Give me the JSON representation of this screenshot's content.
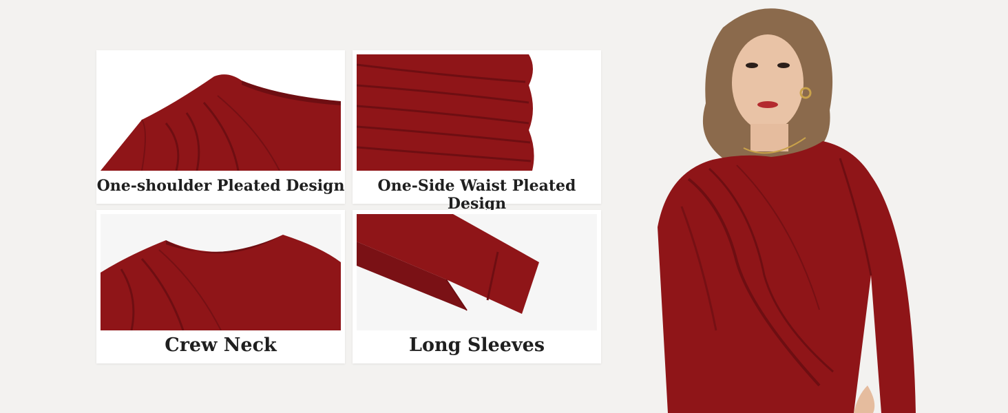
{
  "colors": {
    "background": "#f3f2f0",
    "card": "#ffffff",
    "fabric": "#8f1518",
    "fabric_dark": "#6e0e12",
    "caption_text": "#1f1f1f"
  },
  "features": [
    {
      "caption": "One-shoulder Pleated Design",
      "image": "shoulder-pleat-closeup"
    },
    {
      "caption": "One-Side Waist Pleated Design",
      "image": "waist-pleat-closeup"
    },
    {
      "caption": "Crew Neck",
      "image": "crew-neck-closeup"
    },
    {
      "caption": "Long Sleeves",
      "image": "sleeve-cuff-closeup"
    }
  ],
  "model": {
    "image": "model-wearing-red-top"
  }
}
